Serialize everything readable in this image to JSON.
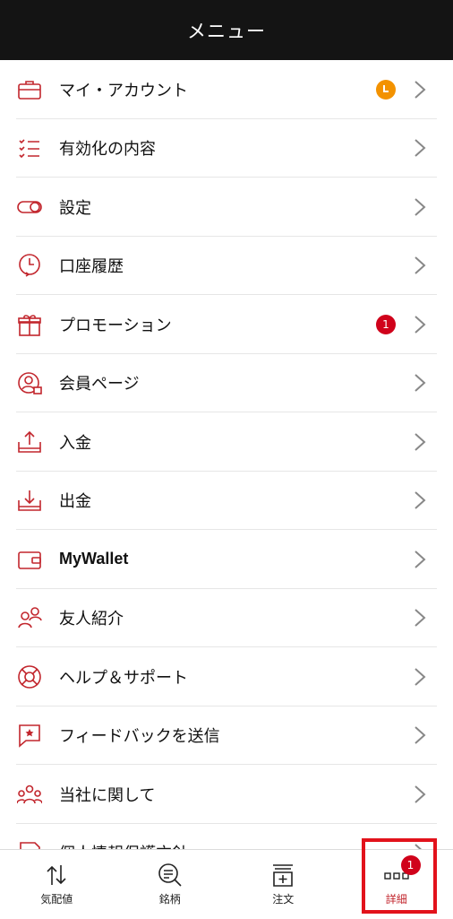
{
  "header": {
    "title": "メニュー"
  },
  "menu": {
    "items": [
      {
        "label": "マイ・アカウント",
        "icon": "briefcase-icon"
      },
      {
        "label": "有効化の内容",
        "icon": "checklist-icon"
      },
      {
        "label": "設定",
        "icon": "toggle-icon"
      },
      {
        "label": "口座履歴",
        "icon": "history-clock-icon"
      },
      {
        "label": "プロモーション",
        "icon": "gift-icon",
        "badge": "1"
      },
      {
        "label": "会員ページ",
        "icon": "user-lock-icon"
      },
      {
        "label": "入金",
        "icon": "deposit-icon"
      },
      {
        "label": "出金",
        "icon": "withdraw-icon"
      },
      {
        "label": "MyWallet",
        "icon": "wallet-icon"
      },
      {
        "label": "友人紹介",
        "icon": "friends-icon"
      },
      {
        "label": "ヘルプ＆サポート",
        "icon": "lifebuoy-icon"
      },
      {
        "label": "フィードバックを送信",
        "icon": "feedback-icon"
      },
      {
        "label": "当社に関して",
        "icon": "company-icon"
      },
      {
        "label": "個人情報保護方針",
        "icon": "document-icon"
      }
    ],
    "account_status_icon": "clock-icon"
  },
  "bottom_nav": {
    "tabs": [
      {
        "label": "気配値",
        "icon": "quotes-icon"
      },
      {
        "label": "銘柄",
        "icon": "search-list-icon"
      },
      {
        "label": "注文",
        "icon": "order-icon"
      },
      {
        "label": "詳細",
        "icon": "more-icon",
        "badge": "1"
      }
    ]
  },
  "colors": {
    "accent": "#c2262d",
    "header_bg": "#141414",
    "badge_red": "#d0021b",
    "badge_orange": "#f39200"
  }
}
